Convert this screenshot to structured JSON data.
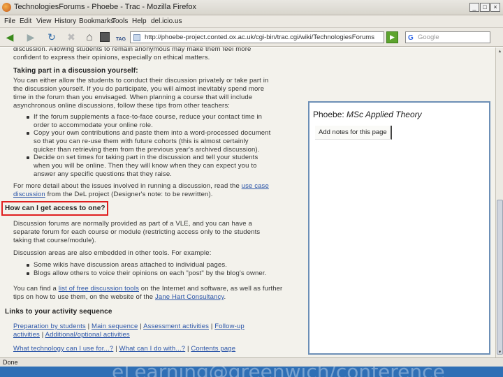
{
  "window": {
    "title": "TechnologiesForums - Phoebe - Trac - Mozilla Firefox",
    "minimize_glyph": "_",
    "maximize_glyph": "□",
    "close_glyph": "×"
  },
  "menu": [
    "File",
    "Edit",
    "View",
    "History",
    "Bookmarks",
    "Tools",
    "Help",
    "del.icio.us"
  ],
  "toolbar": {
    "url": "http://phoebe-project.conted.ox.ac.uk/cgi-bin/trac.cgi/wiki/TechnologiesForums",
    "search_placeholder": "Google",
    "back_glyph": "◀",
    "forward_glyph": "▶",
    "reload_glyph": "↻",
    "stop_glyph": "✖",
    "home_glyph": "⌂",
    "go_glyph": "▶",
    "tag_label": "TAG"
  },
  "content": {
    "intro_line1": "discussion. Allowing students to remain anonymous may make them feel more",
    "intro_line2": "confident to express their opinions, especially on ethical matters.",
    "heading_taking_part": "Taking part in a discussion yourself:",
    "para1": [
      "You can either allow the students to conduct their discussion privately or take part in",
      "the discussion yourself. If you do participate, you will almost inevitably spend more",
      "time in the forum than you envisaged. When planning a course that will include",
      "asynchronous online discussions, follow these tips from other teachers:"
    ],
    "bullets1": [
      [
        "If the forum supplements a face-to-face course, reduce your contact time in",
        "order to accommodate your online role."
      ],
      [
        "Copy your own contributions and paste them into a word-processed document",
        "so that you can re-use them with future cohorts (this is almost certainly",
        "quicker than retrieving them from the previous year's archived discussion)."
      ],
      [
        "Decide on set times for taking part in the discussion and tell your students",
        "when you will be online. Then they will know when they can expect you to",
        "answer any specific questions that they raise."
      ]
    ],
    "case_study_pre": "For more detail about the issues involved in running a discussion, read the ",
    "case_study_link1": "use case",
    "case_study_link2": "discussion",
    "case_study_post": " from the DeL project (Designer's note: to be rewritten).",
    "highlighted_question": "How can I get access to one?",
    "para2": [
      "Discussion forums are normally provided as part of a VLE, and you can have a",
      "separate forum for each course or module (restricting access only to the students",
      "taking that course/module)."
    ],
    "para3": "Discussion areas are also embedded in other tools. For example:",
    "bullets2": [
      "Some wikis have discussion areas attached to individual pages.",
      "Blogs allow others to voice their opinions on each \"post\" by the blog's owner."
    ],
    "list_pre": "You can find a ",
    "list_link": "list of free discussion tools",
    "list_post": " on the Internet and software, as well as further",
    "list_line2_pre": "tips on how to use them, on the website of the ",
    "list_link2": "Jane Hart Consultancy",
    "list_line2_post": ".",
    "heading_links": "Links to your activity sequence",
    "links_line1": [
      {
        "text": "Preparation by students",
        "link": true
      },
      {
        "text": " | ",
        "link": false
      },
      {
        "text": "Main sequence",
        "link": true
      },
      {
        "text": " | ",
        "link": false
      },
      {
        "text": "Assessment activities",
        "link": true
      },
      {
        "text": " | ",
        "link": false
      },
      {
        "text": "Follow-up",
        "link": true
      }
    ],
    "links_line2": [
      {
        "text": "activities",
        "link": true
      },
      {
        "text": " | ",
        "link": false
      },
      {
        "text": "Additional/optional activities",
        "link": true
      }
    ],
    "links_line3": [
      {
        "text": "What technology can I use for...?",
        "link": true
      },
      {
        "text": " | ",
        "link": false
      },
      {
        "text": "What can I do with...?",
        "link": true
      },
      {
        "text": " | ",
        "link": false
      },
      {
        "text": "Contents page",
        "link": true
      }
    ]
  },
  "notes_panel": {
    "title_prefix": "Phoebe: ",
    "title_name": "MSc Applied Theory",
    "add_notes_button": "Add notes for this page"
  },
  "status_bar": {
    "text": "Done"
  },
  "slide_watermark": "eLearning@greenwich/conference",
  "colors": {
    "highlight_border": "#e02020",
    "link": "#2b55a8",
    "panel_border": "#6c8fb6"
  }
}
